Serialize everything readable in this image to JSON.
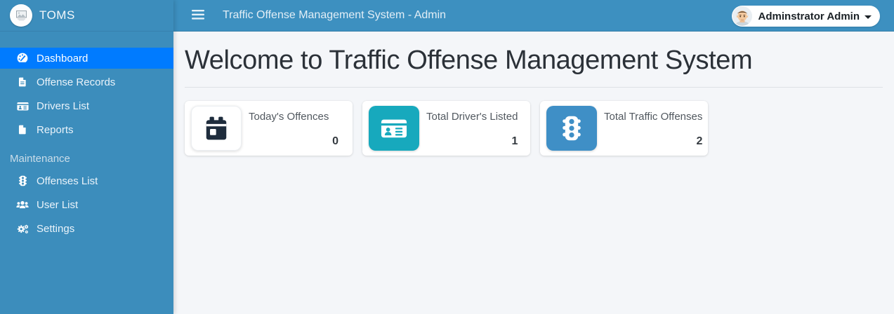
{
  "brand": {
    "title": "TOMS",
    "logo_icon": "broken-image-icon"
  },
  "navbar": {
    "title": "Traffic Offense Management System - Admin",
    "menu_icon": "hamburger-menu-icon",
    "user": {
      "name": "Adminstrator Admin",
      "avatar_icon": "user-avatar",
      "caret_icon": "caret-down-icon"
    }
  },
  "sidebar": {
    "items": [
      {
        "label": "Dashboard",
        "icon": "speedometer-icon",
        "active": true
      },
      {
        "label": "Offense Records",
        "icon": "file-lines-icon",
        "active": false
      },
      {
        "label": "Drivers List",
        "icon": "id-card-icon",
        "active": false
      },
      {
        "label": "Reports",
        "icon": "file-icon",
        "active": false
      }
    ],
    "section_label": "Maintenance",
    "maintenance_items": [
      {
        "label": "Offenses List",
        "icon": "traffic-light-icon",
        "active": false
      },
      {
        "label": "User List",
        "icon": "users-icon",
        "active": false
      },
      {
        "label": "Settings",
        "icon": "gears-icon",
        "active": false
      }
    ]
  },
  "main": {
    "heading": "Welcome to Traffic Offense Management System",
    "cards": [
      {
        "title": "Today's Offences",
        "count": "0",
        "icon": "calendar-icon",
        "icon_bg": "#ffffff",
        "icon_color": "#1f2d3d"
      },
      {
        "title": "Total Driver's Listed",
        "count": "1",
        "icon": "id-card-icon",
        "icon_bg": "#17a9bd",
        "icon_color": "#ffffff"
      },
      {
        "title": "Total Traffic Offenses",
        "count": "2",
        "icon": "traffic-light-icon",
        "icon_bg": "#3f8fc6",
        "icon_color": "#ffffff"
      }
    ]
  },
  "colors": {
    "sidebar_bg": "#3c8dbc",
    "navbar_bg": "#3d90c0",
    "active_item_bg": "#007bff",
    "content_bg": "#f4f6f9",
    "card_bg": "#ffffff",
    "teal_icon_bg": "#17a9bd",
    "blue_icon_bg": "#3f8fc6",
    "dark_icon": "#1f2d3d",
    "heading_text": "#2b3138"
  }
}
